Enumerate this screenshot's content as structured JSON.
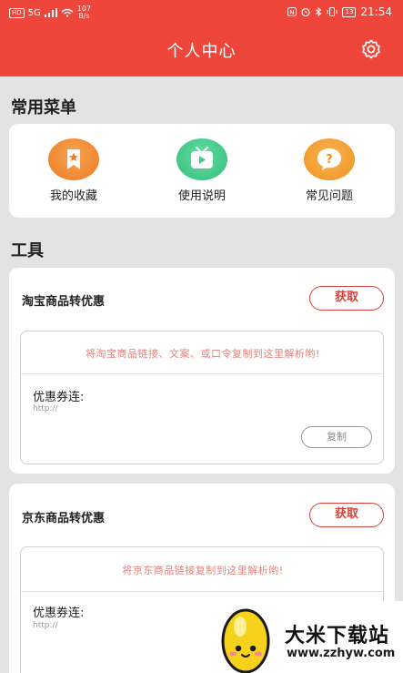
{
  "status_bar": {
    "left_chip": "HD",
    "signal": "5G",
    "speed_top": "107",
    "speed_bottom": "B/s",
    "time": "21:54",
    "battery": "13"
  },
  "header": {
    "title": "个人中心",
    "settings_icon": "gear-icon"
  },
  "menu": {
    "title": "常用菜单",
    "items": [
      {
        "label": "我的收藏",
        "icon": "star-bookmark-icon",
        "color": "#f08a2c"
      },
      {
        "label": "使用说明",
        "icon": "tv-play-icon",
        "color": "#3fca8a"
      },
      {
        "label": "常见问题",
        "icon": "question-bubble-icon",
        "color": "#f5a23a"
      }
    ]
  },
  "tools": {
    "title": "工具",
    "taobao": {
      "title": "淘宝商品转优惠",
      "button": "获取",
      "hint": "将淘宝商品链接、文案、或口令复制到这里解析哟!",
      "coupon_label": "优惠券连:",
      "url": "http://",
      "copy_button": "复制"
    },
    "jd": {
      "title": "京东商品转优惠",
      "button": "获取",
      "hint": "将京东商品链接复制到这里解析哟!",
      "coupon_label": "优惠券连:",
      "url": "http://"
    }
  },
  "watermark": {
    "name": "大米下载站",
    "url": "www.zzhyw.com"
  },
  "colors": {
    "header": "#ee463b",
    "accent": "#d9403a",
    "background": "#e3e3e3"
  }
}
